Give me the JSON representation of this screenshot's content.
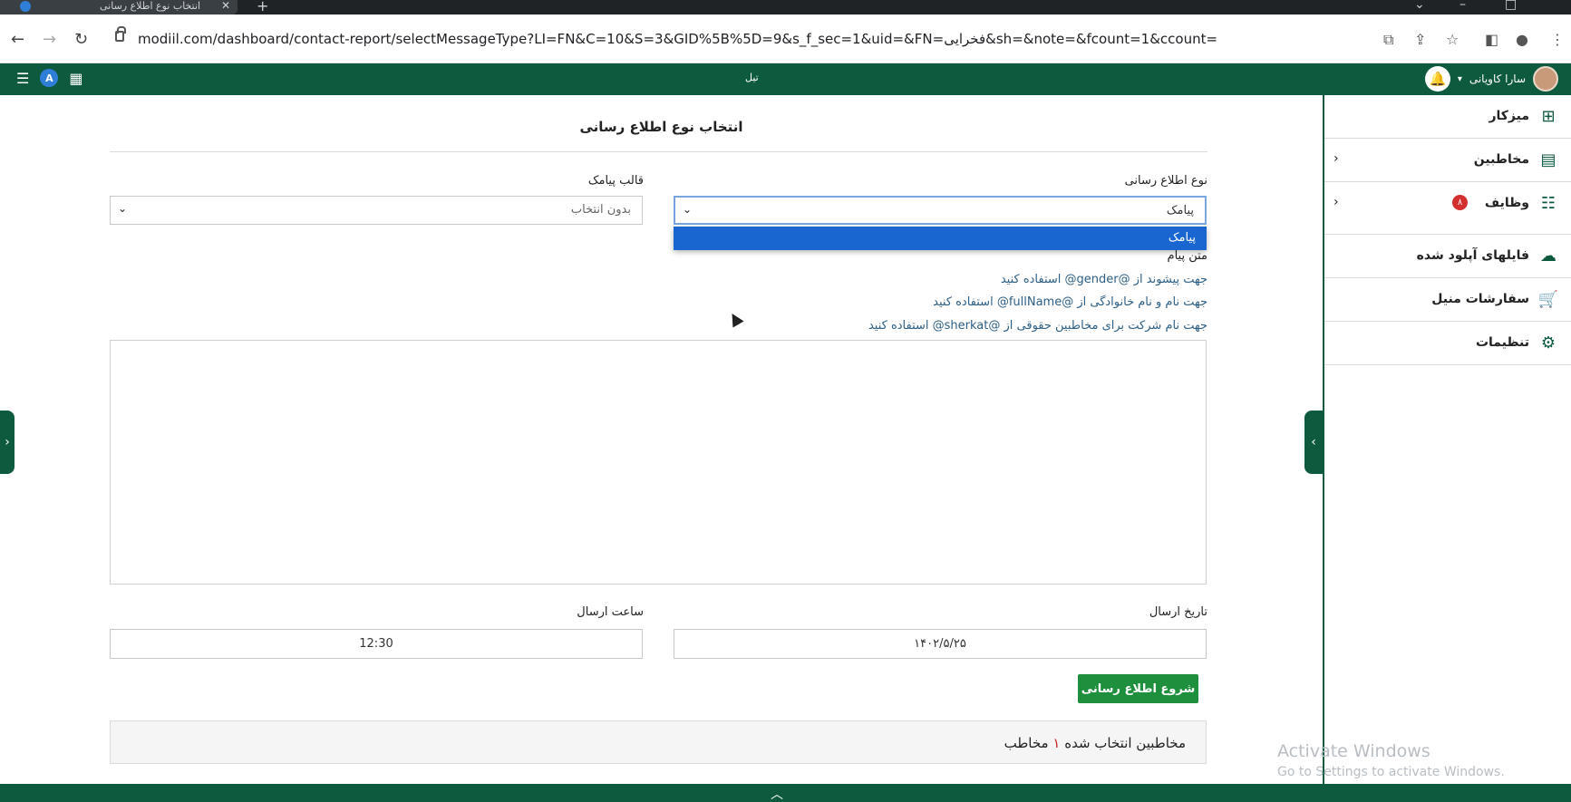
{
  "browser": {
    "tab_title": "انتخاب نوع اطلاع رسانی",
    "url": "modiil.com/dashboard/contact-report/selectMessageType?LI=FN&C=10&S=3&GID%5B%5D=9&s_f_sec=1&uid=&FN=فخرایی&sh=&note=&fcount=1&ccount="
  },
  "appbar": {
    "center_text": "تیل",
    "user_name": "سارا کاویانی"
  },
  "page": {
    "title": "انتخاب نوع اطلاع رسانی"
  },
  "form": {
    "notify_type_label": "نوع اطلاع رسانی",
    "notify_type_value": "پیامک",
    "notify_type_options": [
      "پیامک"
    ],
    "template_label": "قالب پیامک",
    "template_value": "بدون انتخاب",
    "message_label": "متن پیام",
    "hints": [
      "جهت پیشوند از @gender@ استفاده کنید",
      "جهت نام و نام خانوادگی از @fullName@ استفاده کنید",
      "جهت نام شرکت برای مخاطبین حقوقی از @sherkat@ استفاده کنید"
    ],
    "send_date_label": "تاریخ ارسال",
    "send_date_value": "۱۴۰۲/۵/۲۵",
    "send_time_label": "ساعت ارسال",
    "send_time_value": "12:30",
    "start_button": "شروع اطلاع رسانی",
    "summary_prefix": "مخاطبین انتخاب شده",
    "summary_count": "۱",
    "summary_suffix": "مخاطب"
  },
  "sidebar": {
    "items": [
      {
        "label": "میزکار",
        "icon": "dashboard-icon"
      },
      {
        "label": "مخاطبین",
        "icon": "contacts-icon"
      },
      {
        "label": "وظایف",
        "icon": "tasks-icon",
        "badge": "۸"
      },
      {
        "label": "فایلهای آپلود شده",
        "icon": "cloud-upload-icon"
      },
      {
        "label": "سفارشات منیل",
        "icon": "cart-icon"
      },
      {
        "label": "تنظیمات",
        "icon": "gear-icon"
      }
    ]
  },
  "watermark": {
    "line1": "Activate Windows",
    "line2": "Go to Settings to activate Windows."
  },
  "colors": {
    "brand_green": "#0d5a3f",
    "button_green": "#1e8f3c",
    "dropdown_blue": "#1a66d1",
    "badge_red": "#d32f2f"
  }
}
